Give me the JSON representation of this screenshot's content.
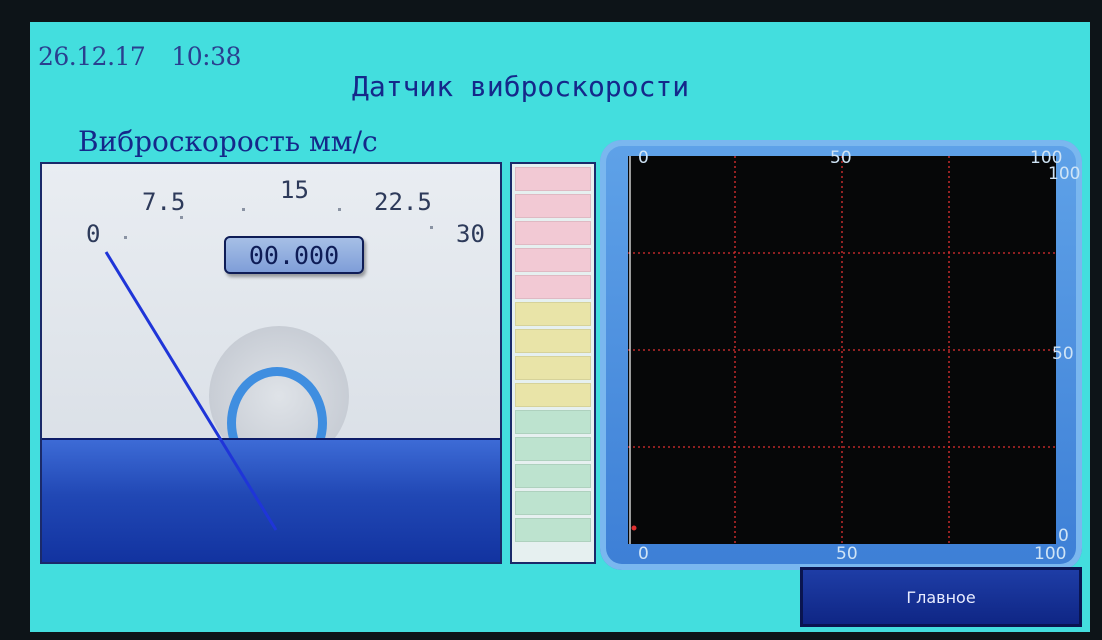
{
  "header": {
    "date": "26.12.17",
    "time": "10:38",
    "title": "Датчик виброскорости"
  },
  "gauge": {
    "label": "Виброскорость мм/с",
    "scale_labels": [
      "0",
      "7.5",
      "15",
      "22.5",
      "30"
    ],
    "readout": "00.000",
    "min": 0,
    "max": 30,
    "value": 0
  },
  "bargraph": {
    "segment_colors": [
      "#f2c9d4",
      "#f2c9d4",
      "#f2c9d4",
      "#f2c9d4",
      "#f2c9d4",
      "#e9e4a8",
      "#e9e4a8",
      "#e9e4a8",
      "#e9e4a8",
      "#bde3cf",
      "#bde3cf",
      "#bde3cf",
      "#bde3cf",
      "#bde3cf"
    ],
    "fill_level": 0
  },
  "trend": {
    "top_labels": [
      "0",
      "50",
      "100"
    ],
    "bottom_labels": [
      "0",
      "50",
      "100"
    ],
    "right_labels": [
      "100",
      "50",
      "0"
    ],
    "grid_color": "#e03030",
    "background": "#060708"
  },
  "footer": {
    "main_button_label": "Главное"
  },
  "colors": {
    "screen_bg": "#43dede",
    "text_primary": "#15288a",
    "needle": "#1f35d8"
  }
}
